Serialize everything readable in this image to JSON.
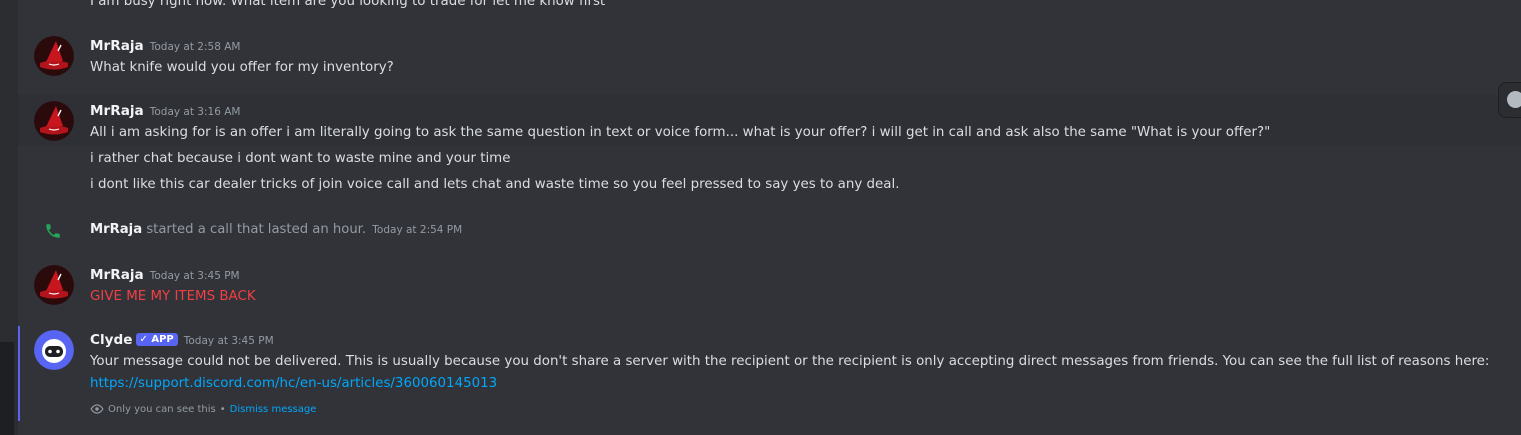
{
  "messages": {
    "top_cut_text": "I am busy right now. What item are you looking to trade for let me know first",
    "g1": {
      "author": "MrRaja",
      "time": "Today at 2:58 AM",
      "lines": [
        "What knife would you offer for my inventory?"
      ]
    },
    "g2": {
      "author": "MrRaja",
      "time": "Today at 3:16 AM",
      "lines": [
        "All i am asking for is an offer i am literally going to ask the same question in text or voice form... what is your offer? i will get in call and ask also the same \"What is your offer?\"",
        "i rather chat because i dont want to waste mine and your time",
        "i dont like this car dealer tricks of join voice call and lets chat and waste time so you feel pressed to say yes to any deal."
      ]
    },
    "call": {
      "author": "MrRaja",
      "text": "started a call that lasted an hour.",
      "time": "Today at 2:54 PM"
    },
    "g3": {
      "author": "MrRaja",
      "time": "Today at 3:45 PM",
      "lines": [
        "GIVE ME MY ITEMS BACK"
      ]
    },
    "clyde": {
      "author": "Clyde",
      "badge": "APP",
      "time": "Today at 3:45 PM",
      "line1": "Your message could not be delivered. This is usually because you don't share a server with the recipient or the recipient is only accepting direct messages from friends. You can see the full list of reasons here:",
      "link": "https://support.discord.com/hc/en-us/articles/360060145013",
      "ephemeral_text": "Only you can see this",
      "separator": "•",
      "dismiss": "Dismiss message"
    }
  },
  "colors": {
    "accent": "#5865f2",
    "link": "#00a8fc",
    "danger": "#f23f43",
    "call_green": "#23a55a"
  },
  "icons": {
    "avatar": "red-witch-hat-avatar",
    "clyde_avatar": "clyde-bot-avatar",
    "call": "phone-icon",
    "eye": "eye-icon",
    "reaction": "smiley-icon"
  }
}
